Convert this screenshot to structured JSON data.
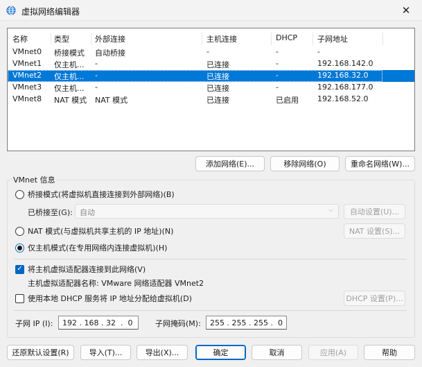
{
  "window": {
    "title": "虚拟网络编辑器",
    "close_glyph": "✕"
  },
  "list": {
    "columns": [
      "名称",
      "类型",
      "外部连接",
      "主机连接",
      "DHCP",
      "子网地址"
    ],
    "rows": [
      [
        "VMnet0",
        "桥接模式",
        "自动桥接",
        "-",
        "-",
        "-"
      ],
      [
        "VMnet1",
        "仅主机...",
        "-",
        "已连接",
        "-",
        "192.168.142.0"
      ],
      [
        "VMnet2",
        "仅主机...",
        "-",
        "已连接",
        "-",
        "192.168.32.0"
      ],
      [
        "VMnet3",
        "仅主机...",
        "-",
        "已连接",
        "-",
        "192.168.177.0"
      ],
      [
        "VMnet8",
        "NAT 模式",
        "NAT 模式",
        "已连接",
        "已启用",
        "192.168.52.0"
      ]
    ],
    "selected_row": 2
  },
  "list_buttons": {
    "add": "添加网络(E)...",
    "remove": "移除网络(O)",
    "rename": "重命名网络(W)..."
  },
  "vmnet_info": {
    "title": "VMnet 信息",
    "bridged_radio": "桥接模式(将虚拟机直接连接到外部网络)(B)",
    "bridged_to_label": "已桥接至(G):",
    "bridged_to_value": "自动",
    "auto_settings_button": "自动设置(U)...",
    "nat_radio": "NAT 模式(与虚拟机共享主机的 IP 地址)(N)",
    "nat_settings_button": "NAT 设置(S)...",
    "hostonly_radio": "仅主机模式(在专用网络内连接虚拟机)(H)",
    "selected_mode": "hostonly",
    "connect_adapter_check": "将主机虚拟适配器连接到此网络(V)",
    "connect_adapter_checked": true,
    "adapter_name_label": "主机虚拟适配器名称: VMware 网络适配器 VMnet2",
    "dhcp_check": "使用本地 DHCP 服务将 IP 地址分配给虚拟机(D)",
    "dhcp_checked": false,
    "dhcp_settings_button": "DHCP 设置(P)...",
    "subnet_ip_label": "子网 IP (I):",
    "subnet_ip_value": "192 . 168 . 32  .  0",
    "subnet_mask_label": "子网掩码(M):",
    "subnet_mask_value": "255 . 255 . 255 .  0"
  },
  "footer_buttons": {
    "restore": "还原默认设置(R)",
    "import": "导入(T)...",
    "export": "导出(X)...",
    "ok": "确定",
    "cancel": "取消",
    "apply": "应用(A)",
    "help": "帮助"
  },
  "colors": {
    "selection": "#0078d7",
    "accent": "#0067c0",
    "background": "#f0f0f0"
  },
  "icons": {
    "app": "network-globe-icon",
    "close": "close-icon"
  }
}
